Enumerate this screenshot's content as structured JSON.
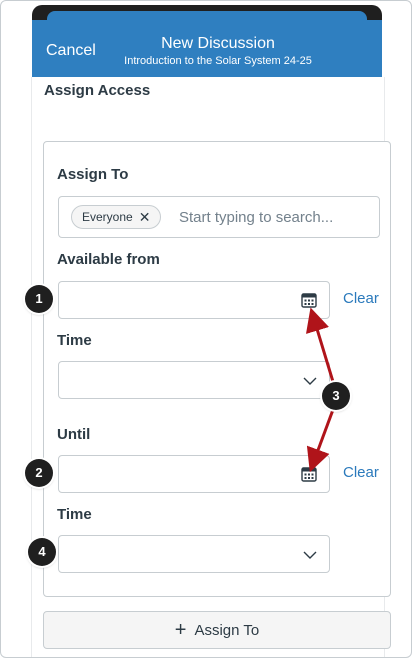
{
  "header": {
    "cancel_label": "Cancel",
    "title": "New Discussion",
    "subtitle": "Introduction to the Solar System  24-25",
    "color": "#2f7fc0"
  },
  "section_heading": "Assign Access",
  "assign_to": {
    "label": "Assign To",
    "pill_label": "Everyone",
    "pill_remove": "✕",
    "search_placeholder": "Start typing to search..."
  },
  "available_from": {
    "label": "Available from",
    "value": "",
    "clear_label": "Clear"
  },
  "time_1": {
    "label": "Time",
    "value": ""
  },
  "until": {
    "label": "Until",
    "value": "",
    "clear_label": "Clear"
  },
  "time_2": {
    "label": "Time",
    "value": ""
  },
  "add_button": {
    "icon": "plus-icon",
    "label": "Assign To"
  },
  "callouts": [
    "1",
    "2",
    "3",
    "4"
  ],
  "colors": {
    "link": "#2b7abc",
    "arrow": "#b0141a",
    "badge": "#1f1f1f"
  }
}
